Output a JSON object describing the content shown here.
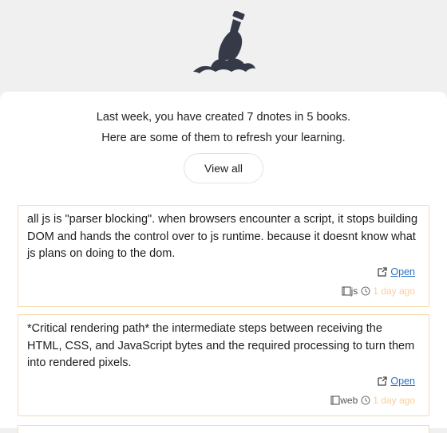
{
  "summary": {
    "line1": "Last week, you have created 7 dnotes in 5 books.",
    "line2": "Here are some of them to refresh your learning.",
    "view_all_label": "View all"
  },
  "notes": [
    {
      "text": "all js is \"parser blocking\". when browsers encounter a script, it stops building DOM and hands the control over to js runtime. because it doesnt know what js plans on doing to the dom.",
      "open_label": "Open",
      "book": "js",
      "time": "1 day ago"
    },
    {
      "text": "*Critical rendering path* the intermediate steps between receiving the HTML, CSS, and JavaScript bytes and the required processing to turn them into rendered pixels.",
      "open_label": "Open",
      "book": "web",
      "time": "1 day ago"
    }
  ],
  "icons": {
    "logo": "bottle-in-water-icon",
    "open": "external-link-icon",
    "book": "book-icon",
    "time": "clock-icon"
  },
  "colors": {
    "accent_link": "#2a72c6",
    "card_border": "#f7dcab",
    "time_text": "#f8cf9c",
    "logo": "#353a48"
  }
}
